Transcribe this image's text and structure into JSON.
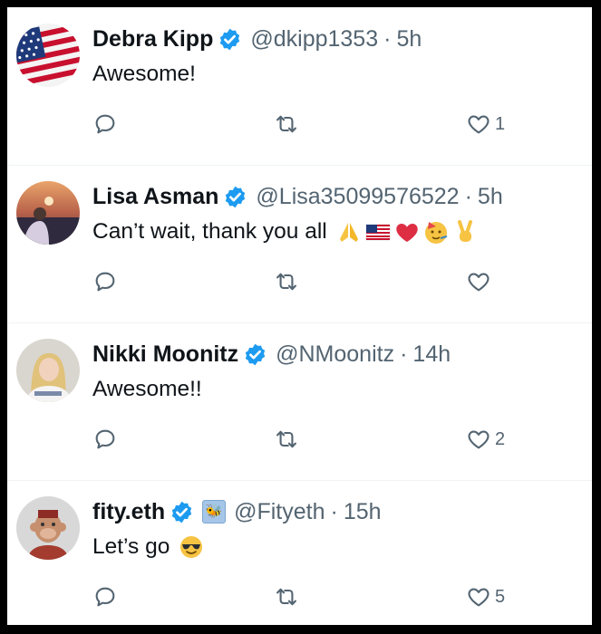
{
  "tweets": [
    {
      "name": "Debra Kipp",
      "handle": "@dkipp1353",
      "separator": "·",
      "time": "5h",
      "text": "Awesome!",
      "emojis": [],
      "likes": "1",
      "avatar_icon": "us-flag-avatar",
      "has_extra_badge": false
    },
    {
      "name": "Lisa Asman",
      "handle": "@Lisa35099576522",
      "separator": "·",
      "time": "5h",
      "text": "Can’t wait, thank you all",
      "emojis": [
        "folded-hands-emoji",
        "us-flag-emoji",
        "red-heart-emoji",
        "partying-face-emoji",
        "victory-hand-emoji"
      ],
      "likes": "",
      "avatar_icon": "sunset-portrait-avatar",
      "has_extra_badge": false
    },
    {
      "name": "Nikki Moonitz",
      "handle": "@NMoonitz",
      "separator": "·",
      "time": "14h",
      "text": "Awesome!!",
      "emojis": [],
      "likes": "2",
      "avatar_icon": "blonde-woman-avatar",
      "has_extra_badge": false
    },
    {
      "name": "fity.eth",
      "handle": "@Fityeth",
      "separator": "·",
      "time": "15h",
      "text": "Let’s go",
      "emojis": [
        "sunglasses-face-emoji"
      ],
      "likes": "5",
      "avatar_icon": "ape-nft-avatar",
      "has_extra_badge": true
    }
  ],
  "colors": {
    "verified": "#1d9bf0",
    "text": "#0f1419",
    "secondary": "#536471",
    "divider": "#eff3f4"
  }
}
